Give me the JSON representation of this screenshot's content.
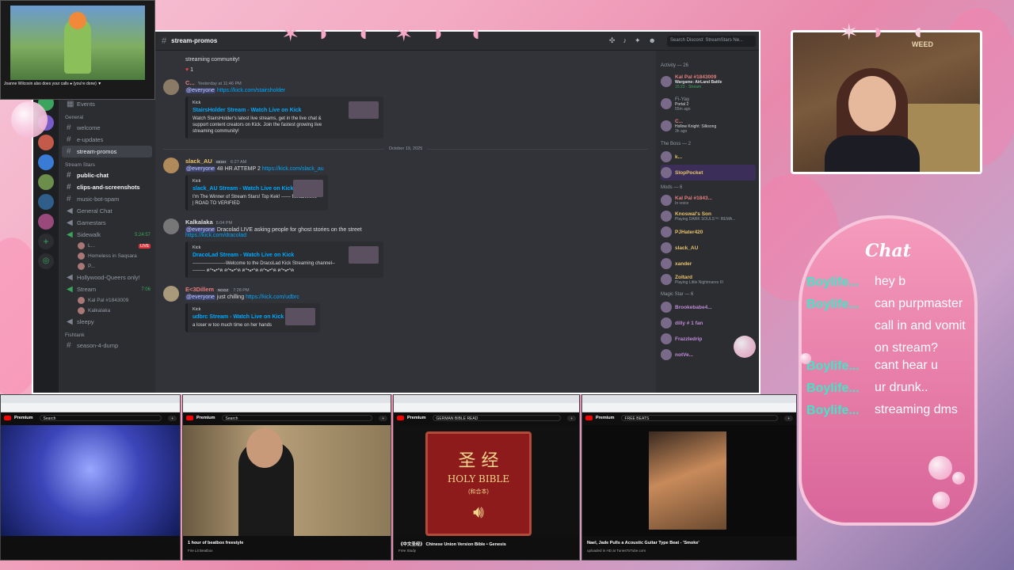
{
  "discord": {
    "channel": "stream-promos",
    "search_placeholder": "Search Discord: StreamStars Ne...",
    "server_events": "Events",
    "categories": {
      "general": "General",
      "stream_stars": "Stream Stars",
      "fishtank": "Fishtank"
    },
    "channels_general": [
      "welcome",
      "e-updates",
      "stream-promos"
    ],
    "channels_stream": [
      "public-chat",
      "clips-and-screenshots",
      "music-bot-spam",
      "General Chat",
      "Gamestars"
    ],
    "voice": {
      "sidewalk": "Sidewalk",
      "sidewalk_time": "5:24:57",
      "live": "LIVE",
      "users": [
        "L...",
        "Homeless in Saqsara",
        "P..."
      ],
      "hollywood": "Hollywood-Queers only!",
      "stream": "Stream",
      "stream_time": "7:06",
      "stream_users": [
        "Kal Pal #1843009",
        "Kalkalaka"
      ],
      "sleepy": "sleepy",
      "season": "season-4-dump"
    },
    "top_text": "streaming community!",
    "reaction_count": "1",
    "messages": [
      {
        "user": "C...",
        "time": "Yesterday at 11:46 PM",
        "mention": "@everyone",
        "text": "",
        "link": "https://kick.com/stairsholder",
        "embed": {
          "provider": "Kick",
          "title": "StairsHolder Stream - Watch Live on Kick",
          "desc": "Watch StairsHolder's latest live streams, get in the live chat & support content creators on Kick. Join the fastest growing live streaming community!"
        }
      },
      {
        "user": "slack_AU",
        "badge": "SESH",
        "time": "6:27 AM",
        "mention": "@everyone",
        "text": "48 HR ATTEMP 2",
        "link": "https://kick.com/slack_au",
        "embed": {
          "provider": "Kick",
          "title": "slack_AU Stream - Watch Live on Kick",
          "desc": "I'm The Winner of Stream Stars! Top Kek! ------ fishtank.live | ROAD TO VERIFIED"
        }
      },
      {
        "user": "Kalkalaka",
        "time": "5:04 PM",
        "mention": "@everyone",
        "text": "Dracolad LIVE asking people for ghost stories on the street",
        "link": "https://kick.com/dracolad",
        "embed": {
          "provider": "Kick",
          "title": "DracoLad Stream - Watch Live on Kick",
          "desc": "---------------------Welcome to the DracoLad Kick Streaming channel---------- ฅ^•ﻌ•^ฅ ฅ^•ﻌ•^ฅ ฅ^•ﻌ•^ฅ ฅ^•ﻌ•^ฅ ฅ^•ﻌ•^ฅ"
        }
      },
      {
        "user": "E<3Dillem",
        "badge": "NGGZ",
        "time": "7:28 PM",
        "mention": "@everyone",
        "text": "just chilling",
        "link": "https://kick.com/udbrc",
        "embed": {
          "provider": "Kick",
          "title": "udbrc Stream - Watch Live on Kick",
          "desc": "a loser w too much time on her hands"
        }
      }
    ],
    "date_divider": "October 19, 2025",
    "members": {
      "activity": "Activity — 26",
      "activity_items": [
        {
          "name": "Kal Pal #1843009",
          "sub": "Wargame: AirLand Battle",
          "sub2": "15:23 · Stream"
        },
        {
          "name": "Fi-Yay",
          "sub": "Portal 2",
          "sub2": "55m ago"
        },
        {
          "name": "C...",
          "sub": "Hollow Knight: Silksong",
          "sub2": "3h ago"
        }
      ],
      "boss": "The Boss — 2",
      "boss_items": [
        "k...",
        "SlopPocket"
      ],
      "mods": "Mods — 6",
      "mod_items": [
        {
          "name": "Kal Pal #1843...",
          "sub": "In voice"
        },
        {
          "name": "Knoswal's Son",
          "sub": "Playing DARK SOULS™: REMA..."
        },
        {
          "name": "PJHater420",
          "sub": ""
        },
        {
          "name": "slack_AU",
          "sub": ""
        },
        {
          "name": "xander",
          "sub": ""
        },
        {
          "name": "Zoltard",
          "sub": "Playing Little Nightmares III"
        }
      ],
      "magic": "Magic Star — 6",
      "magic_items": [
        "Brookebabe4...",
        "dilly # 1 fan",
        "Frazzledrip",
        "notVe..."
      ]
    }
  },
  "tl_window": {
    "caption": "Joanne Wilcoxin also does your calls ● (you're done) ▼"
  },
  "chat": {
    "title": "Chat",
    "lines": [
      {
        "user": "Boylife...",
        "text": "hey b"
      },
      {
        "user": "Boylife...",
        "text": "can purpmaster call in and vomit on stream?"
      },
      {
        "user": "Boylife...",
        "text": "cant hear u"
      },
      {
        "user": "Boylife...",
        "text": "ur drunk.."
      },
      {
        "user": "Boylife...",
        "text": "streaming dms"
      }
    ]
  },
  "cam": {
    "sign": "WEED"
  },
  "youtube": [
    {
      "brand": "Premium",
      "search": "Search",
      "title": "",
      "meta": ""
    },
    {
      "brand": "Premium",
      "search": "Search",
      "title": "1 hour of beatbox freestyle",
      "meta": "Fire Lit Beatbox"
    },
    {
      "brand": "Premium",
      "search": "GERMAN BIBLE READ",
      "title": "《中文圣经》 Chinese Union Version Bible • Genesis",
      "meta": "Free Study"
    },
    {
      "brand": "Premium",
      "search": "FREE BEATS",
      "title": "Nael, Jade Pulls a Acoustic Guitar Type Beat - 'Smoke'",
      "meta": "uploaded in HD at TunesToTube.com"
    }
  ],
  "bible": {
    "zh": "圣 经",
    "en": "HOLY BIBLE",
    "sub": "(和合本)"
  },
  "colors": {
    "discord_bg": "#313338",
    "chat_user": "#3fe6c8",
    "accent_pink": "#f59bbc"
  }
}
